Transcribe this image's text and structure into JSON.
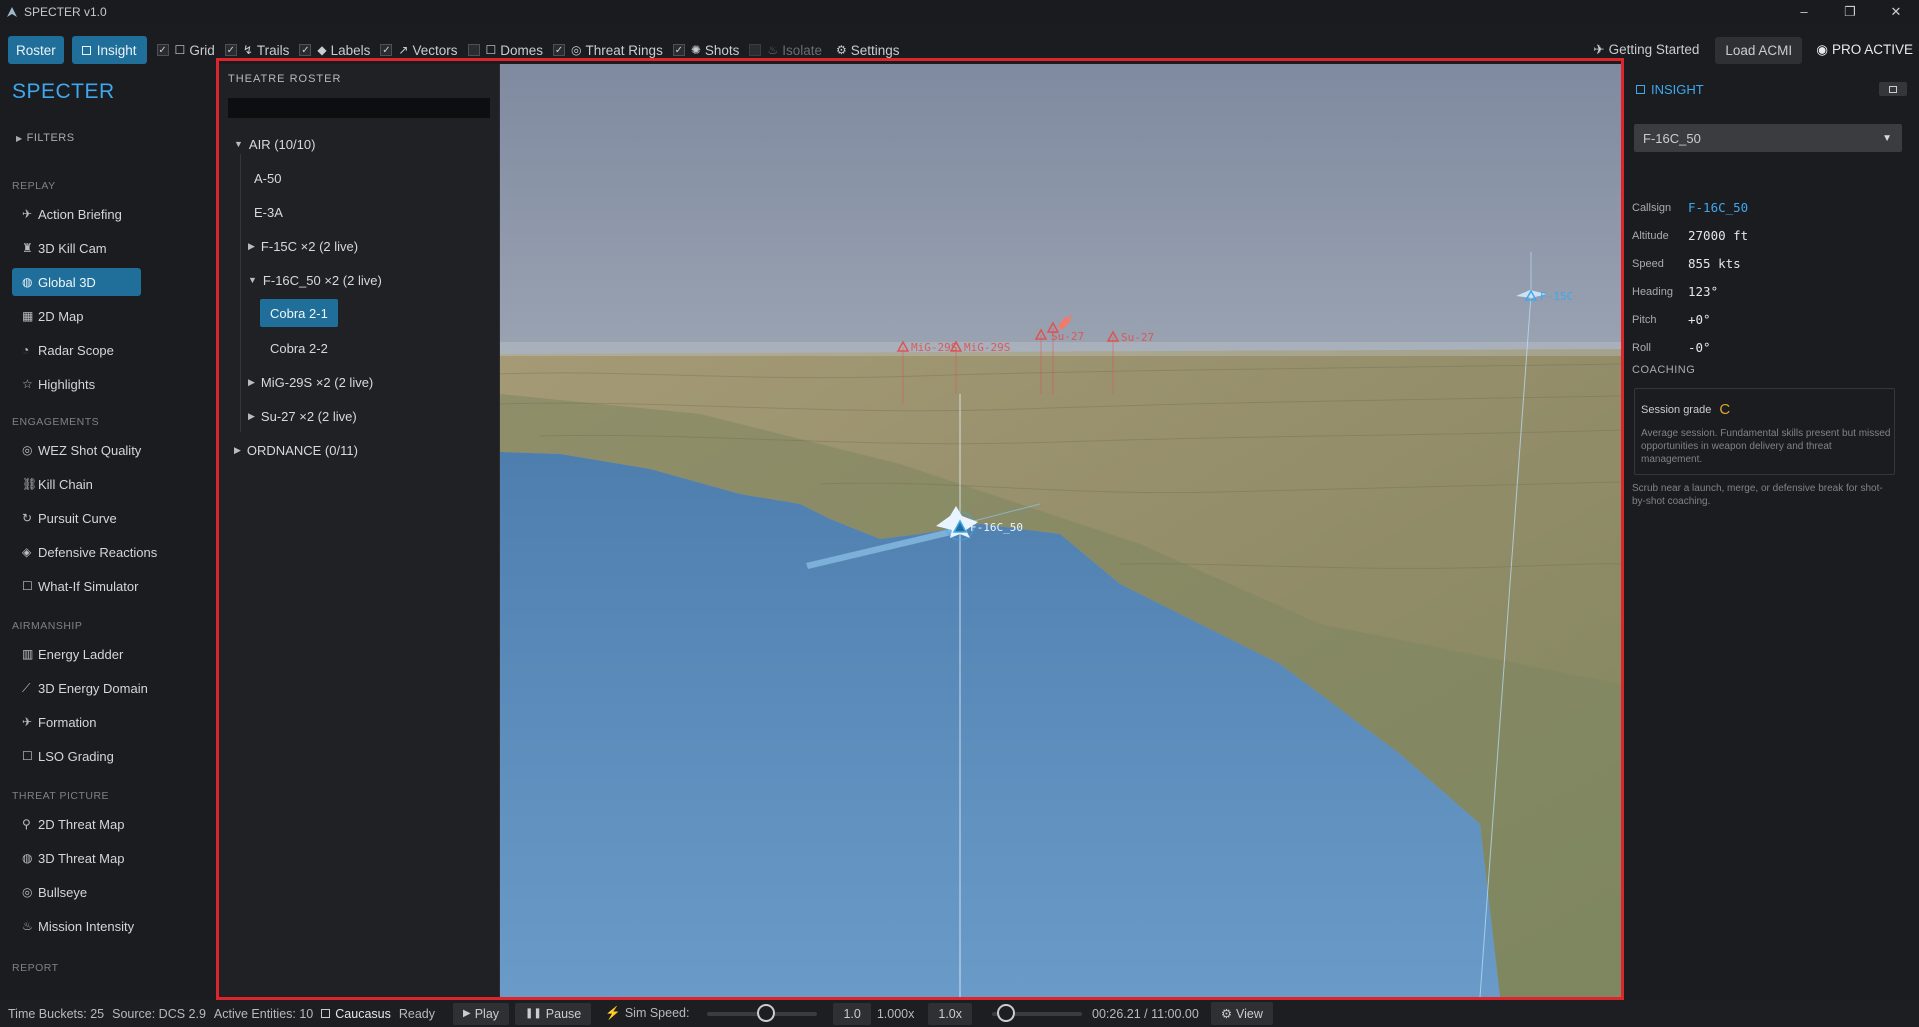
{
  "window": {
    "title": "SPECTER v1.0",
    "controls": [
      "–",
      "❐",
      "✕"
    ]
  },
  "toolbar": {
    "roster_label": "Roster",
    "insight_label": "Insight",
    "toggles": [
      {
        "label": "Grid",
        "checked": true,
        "icon": "grid-icon"
      },
      {
        "label": "Trails",
        "checked": true,
        "icon": "trails-icon"
      },
      {
        "label": "Labels",
        "checked": true,
        "icon": "tag-icon"
      },
      {
        "label": "Vectors",
        "checked": true,
        "icon": "vector-icon"
      },
      {
        "label": "Domes",
        "checked": false,
        "icon": "dome-icon"
      },
      {
        "label": "Threat Rings",
        "checked": true,
        "icon": "rings-icon"
      },
      {
        "label": "Shots",
        "checked": true,
        "icon": "shot-icon"
      },
      {
        "label": "Isolate",
        "checked": false,
        "icon": "isolate-icon",
        "disabled": true
      }
    ],
    "settings_label": "Settings",
    "getting_started_label": "Getting Started",
    "load_acmi_label": "Load ACMI",
    "pro_label": "PRO ACTIVE"
  },
  "sidebar": {
    "brand": "SPECTER",
    "filters_label": "FILTERS",
    "sections": [
      {
        "title": "REPLAY",
        "items": [
          {
            "label": "Action Briefing",
            "icon": "plane-icon"
          },
          {
            "label": "3D Kill Cam",
            "icon": "camera-icon"
          },
          {
            "label": "Global 3D",
            "icon": "globe-icon",
            "active": true
          },
          {
            "label": "2D Map",
            "icon": "map-icon"
          },
          {
            "label": "Radar Scope",
            "icon": "radar-icon"
          },
          {
            "label": "Highlights",
            "icon": "star-icon"
          }
        ]
      },
      {
        "title": "ENGAGEMENTS",
        "items": [
          {
            "label": "WEZ Shot Quality",
            "icon": "target-icon"
          },
          {
            "label": "Kill Chain",
            "icon": "chain-icon"
          },
          {
            "label": "Pursuit Curve",
            "icon": "curve-icon"
          },
          {
            "label": "Defensive Reactions",
            "icon": "shield-icon"
          },
          {
            "label": "What-If Simulator",
            "icon": "square-icon"
          }
        ]
      },
      {
        "title": "AIRMANSHIP",
        "items": [
          {
            "label": "Energy Ladder",
            "icon": "bars-icon"
          },
          {
            "label": "3D Energy Domain",
            "icon": "domain-icon"
          },
          {
            "label": "Formation",
            "icon": "formation-icon"
          },
          {
            "label": "LSO Grading",
            "icon": "square-icon"
          }
        ]
      },
      {
        "title": "THREAT PICTURE",
        "items": [
          {
            "label": "2D Threat Map",
            "icon": "pin-icon"
          },
          {
            "label": "3D Threat Map",
            "icon": "globe-icon"
          },
          {
            "label": "Bullseye",
            "icon": "target-icon"
          },
          {
            "label": "Mission Intensity",
            "icon": "flame-icon"
          }
        ]
      },
      {
        "title": "REPORT",
        "items": []
      }
    ]
  },
  "roster": {
    "title": "THEATRE ROSTER",
    "search_value": "",
    "rows": [
      {
        "label": "AIR  (10/10)",
        "level": 0,
        "expanded": true,
        "tri": "▼"
      },
      {
        "label": "A-50",
        "level": 1
      },
      {
        "label": "E-3A",
        "level": 1
      },
      {
        "label": "F-15C  ×2  (2 live)",
        "level": 1,
        "tri": "▶"
      },
      {
        "label": "F-16C_50  ×2  (2 live)",
        "level": 1,
        "tri": "▼"
      },
      {
        "label": "Cobra 2-1",
        "level": 2,
        "selected": true
      },
      {
        "label": "Cobra 2-2",
        "level": 2
      },
      {
        "label": "MiG-29S  ×2  (2 live)",
        "level": 1,
        "tri": "▶"
      },
      {
        "label": "Su-27  ×2  (2 live)",
        "level": 1,
        "tri": "▶"
      },
      {
        "label": "ORDNANCE  (0/11)",
        "level": 0,
        "tri": "▶"
      }
    ]
  },
  "viewport": {
    "labels": {
      "own": "F-16C_50",
      "f15": "F-15C",
      "mig_a": "MiG-29S",
      "mig_b": "MiG-29S",
      "su_a": "Su-27",
      "su_b": "Su-27"
    },
    "colors": {
      "friendly": "#3ea8ef",
      "hostile": "#e0524e",
      "sea": "#5d8fbf",
      "land": "#8f8a66",
      "sky": "#8792a4"
    }
  },
  "insight": {
    "title": "INSIGHT",
    "selected_entity": "F-16C_50",
    "fields": [
      {
        "k": "Callsign",
        "v": "F-16C_50",
        "accent": true
      },
      {
        "k": "Altitude",
        "v": "27000 ft"
      },
      {
        "k": "Speed",
        "v": "855 kts"
      },
      {
        "k": "Heading",
        "v": "123°"
      },
      {
        "k": "Pitch",
        "v": "+0°"
      },
      {
        "k": "Roll",
        "v": "-0°"
      }
    ],
    "coaching_title": "COACHING",
    "session_grade_label": "Session grade",
    "session_grade": "C",
    "grade_color": "#e0a430",
    "description": "Average session. Fundamental skills present but missed opportunities in weapon delivery and threat management.",
    "hint": "Scrub near a launch, merge, or defensive break for shot-by-shot coaching."
  },
  "status": {
    "time_buckets": "Time Buckets: 25",
    "source": "Source: DCS 2.9",
    "active_entities": "Active Entities: 10",
    "theatre": "Caucasus",
    "state": "Ready",
    "play_label": "Play",
    "pause_label": "Pause",
    "sim_speed_label": "Sim Speed:",
    "speed_value": "1.0",
    "speed_multiplier": "1.000x",
    "speed_preset": "1.0x",
    "speed_slider_fraction": 0.45,
    "time_slider_fraction": 0.05,
    "time_readout": "00:26.21 / 11:00.00",
    "view_label": "View"
  }
}
